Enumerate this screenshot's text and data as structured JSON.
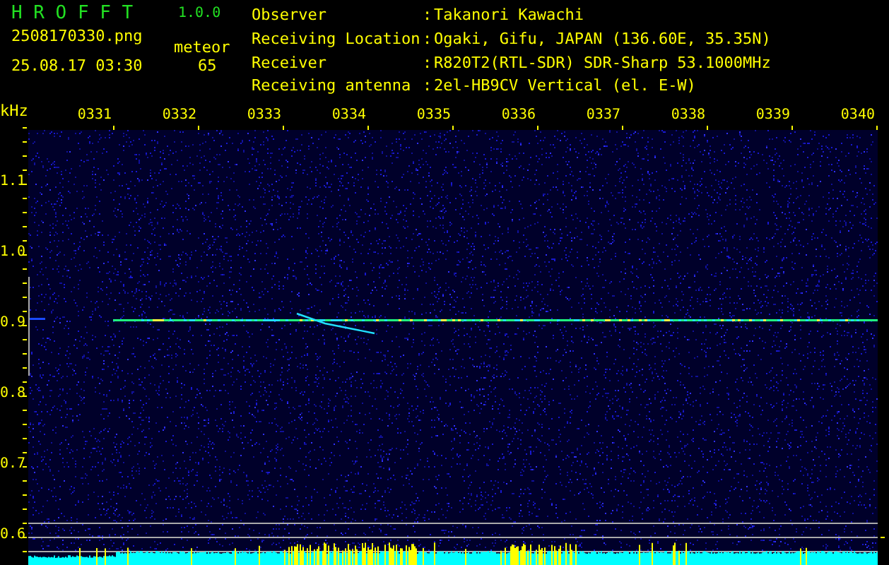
{
  "header": {
    "title": "H R O F F T",
    "version": "1.0.0",
    "filename": "2508170330.png",
    "datetime": "25.08.17 03:30",
    "meteor_label": "meteor",
    "meteor_count": "65"
  },
  "info": [
    {
      "label": "Observer",
      "separator": ":",
      "value": "Takanori Kawachi"
    },
    {
      "label": "Receiving Location",
      "separator": ":",
      "value": "Ogaki, Gifu, JAPAN (136.60E, 35.35N)"
    },
    {
      "label": "Receiver",
      "separator": ":",
      "value": "R820T2(RTL-SDR) SDR-Sharp 53.1000MHz"
    },
    {
      "label": "Receiving antenna",
      "separator": ":",
      "value": "2el-HB9CV Vertical (el. E-W)"
    }
  ],
  "plot": {
    "unit": "kHz",
    "time_ticks": [
      "0331",
      "0332",
      "0333",
      "0334",
      "0335",
      "0336",
      "0337",
      "0338",
      "0339",
      "0340"
    ],
    "freq_ticks": [
      "1.1",
      "1.0",
      "0.9",
      "0.8",
      "0.7",
      "0.6"
    ]
  }
}
